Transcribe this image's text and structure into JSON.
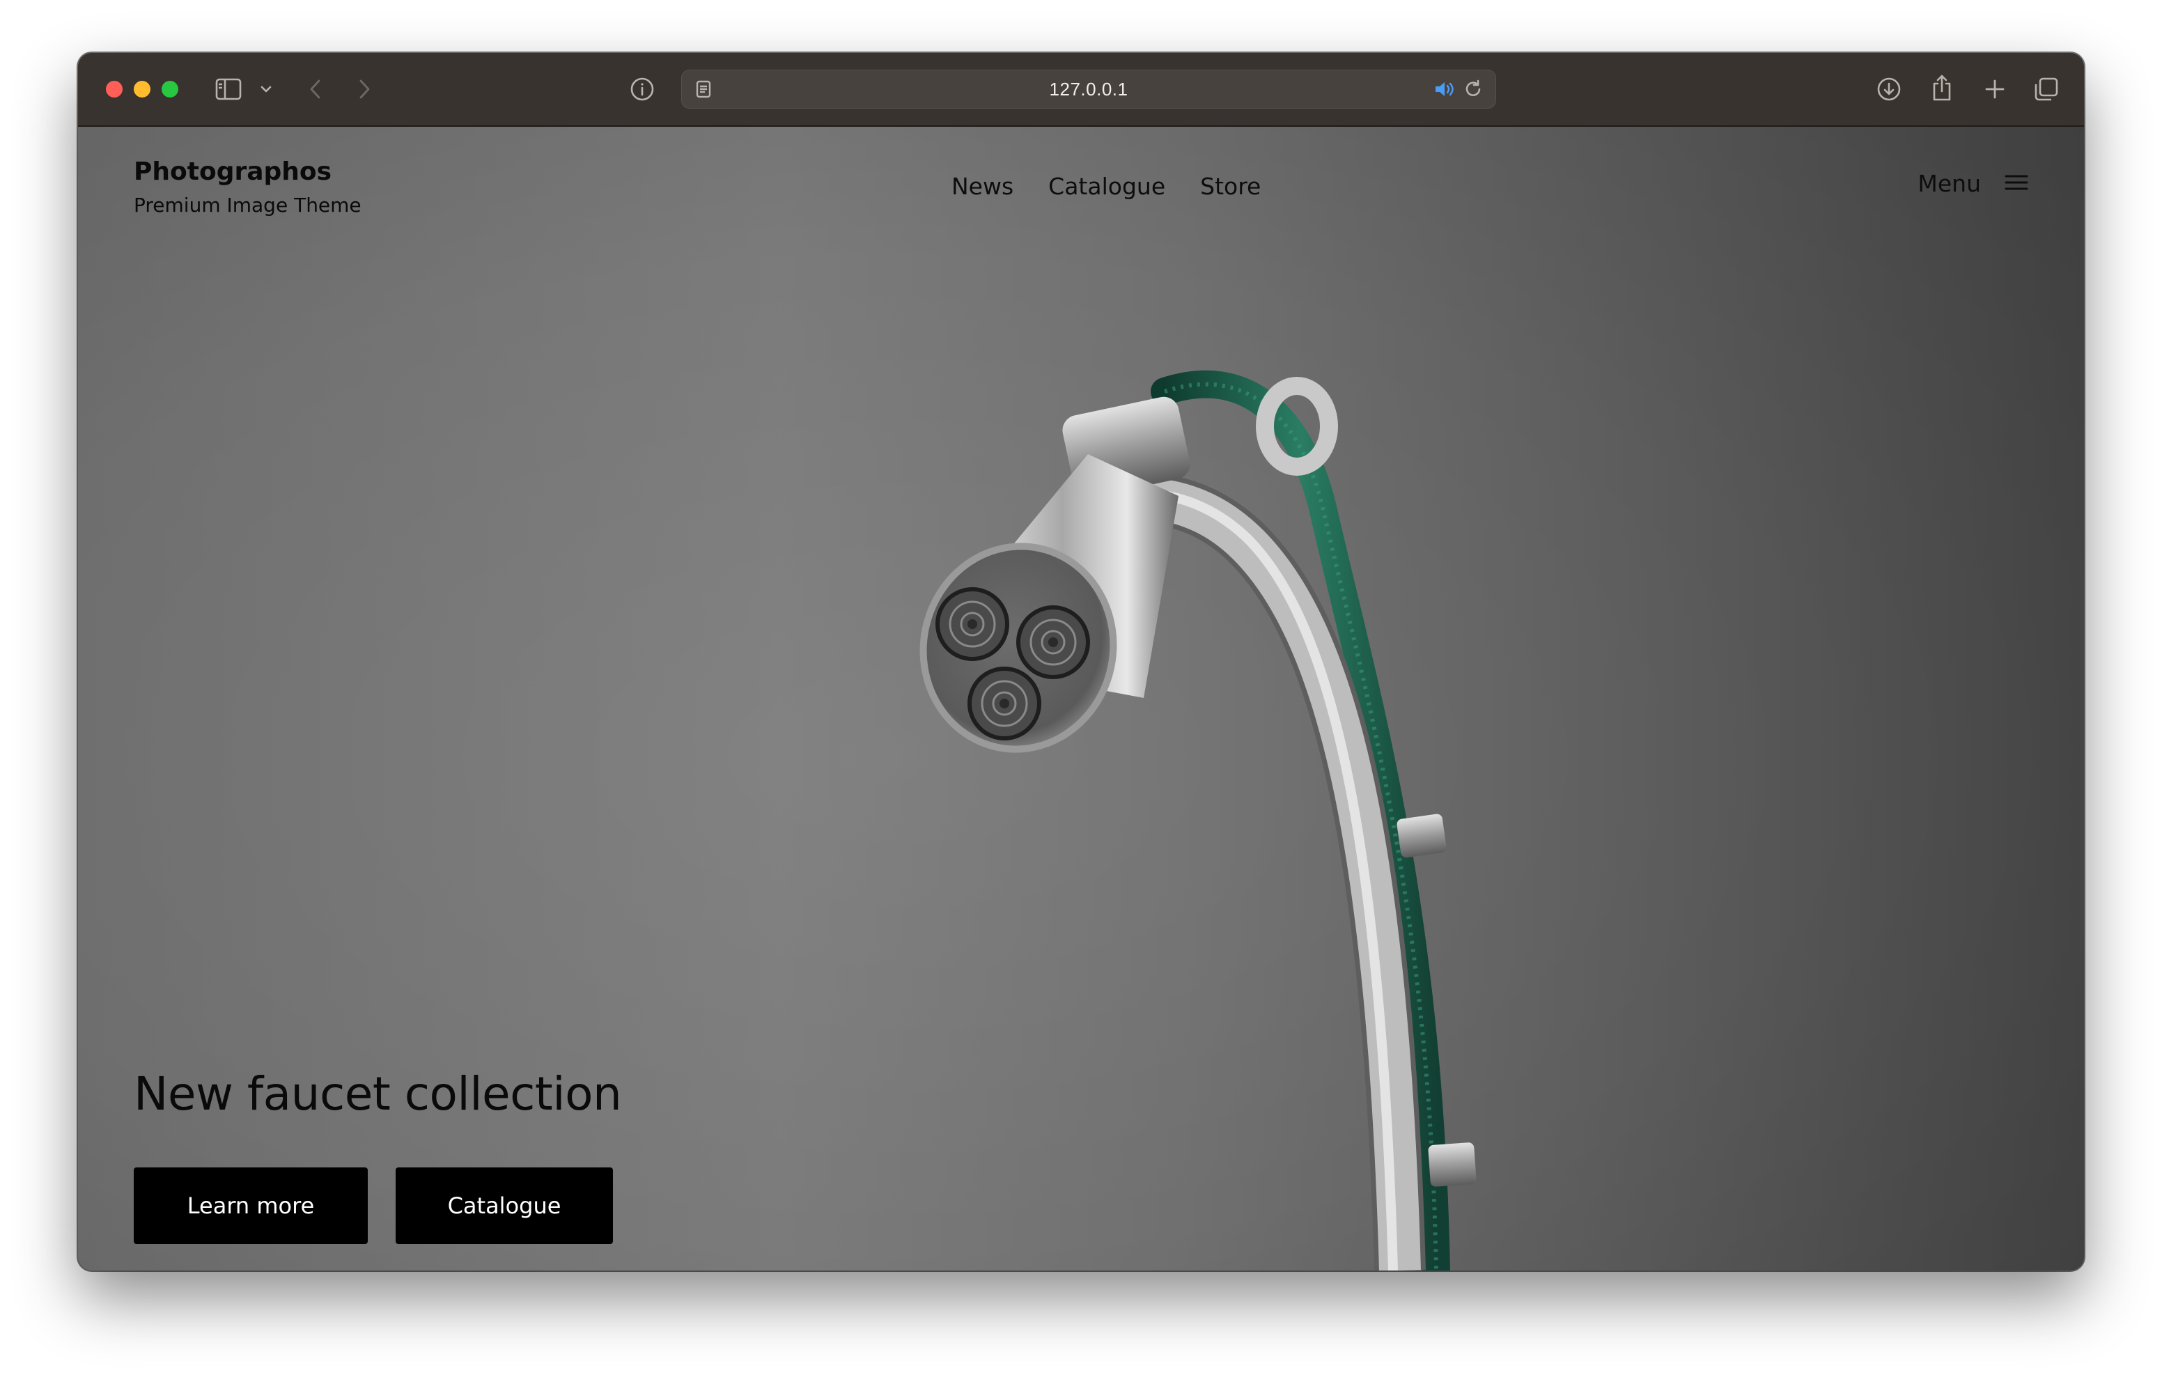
{
  "browser": {
    "url": "127.0.0.1"
  },
  "site": {
    "brand_title": "Photographos",
    "brand_subtitle": "Premium Image Theme"
  },
  "nav": {
    "items": [
      {
        "label": "News"
      },
      {
        "label": "Catalogue"
      },
      {
        "label": "Store"
      }
    ],
    "menu_label": "Menu"
  },
  "hero": {
    "heading": "New faucet collection",
    "buttons": {
      "learn_more": "Learn more",
      "catalogue": "Catalogue"
    }
  },
  "colors": {
    "button_bg": "#000000",
    "button_text": "#ffffff",
    "hose_green": "#1f6b55",
    "background_gray": "#737373"
  }
}
